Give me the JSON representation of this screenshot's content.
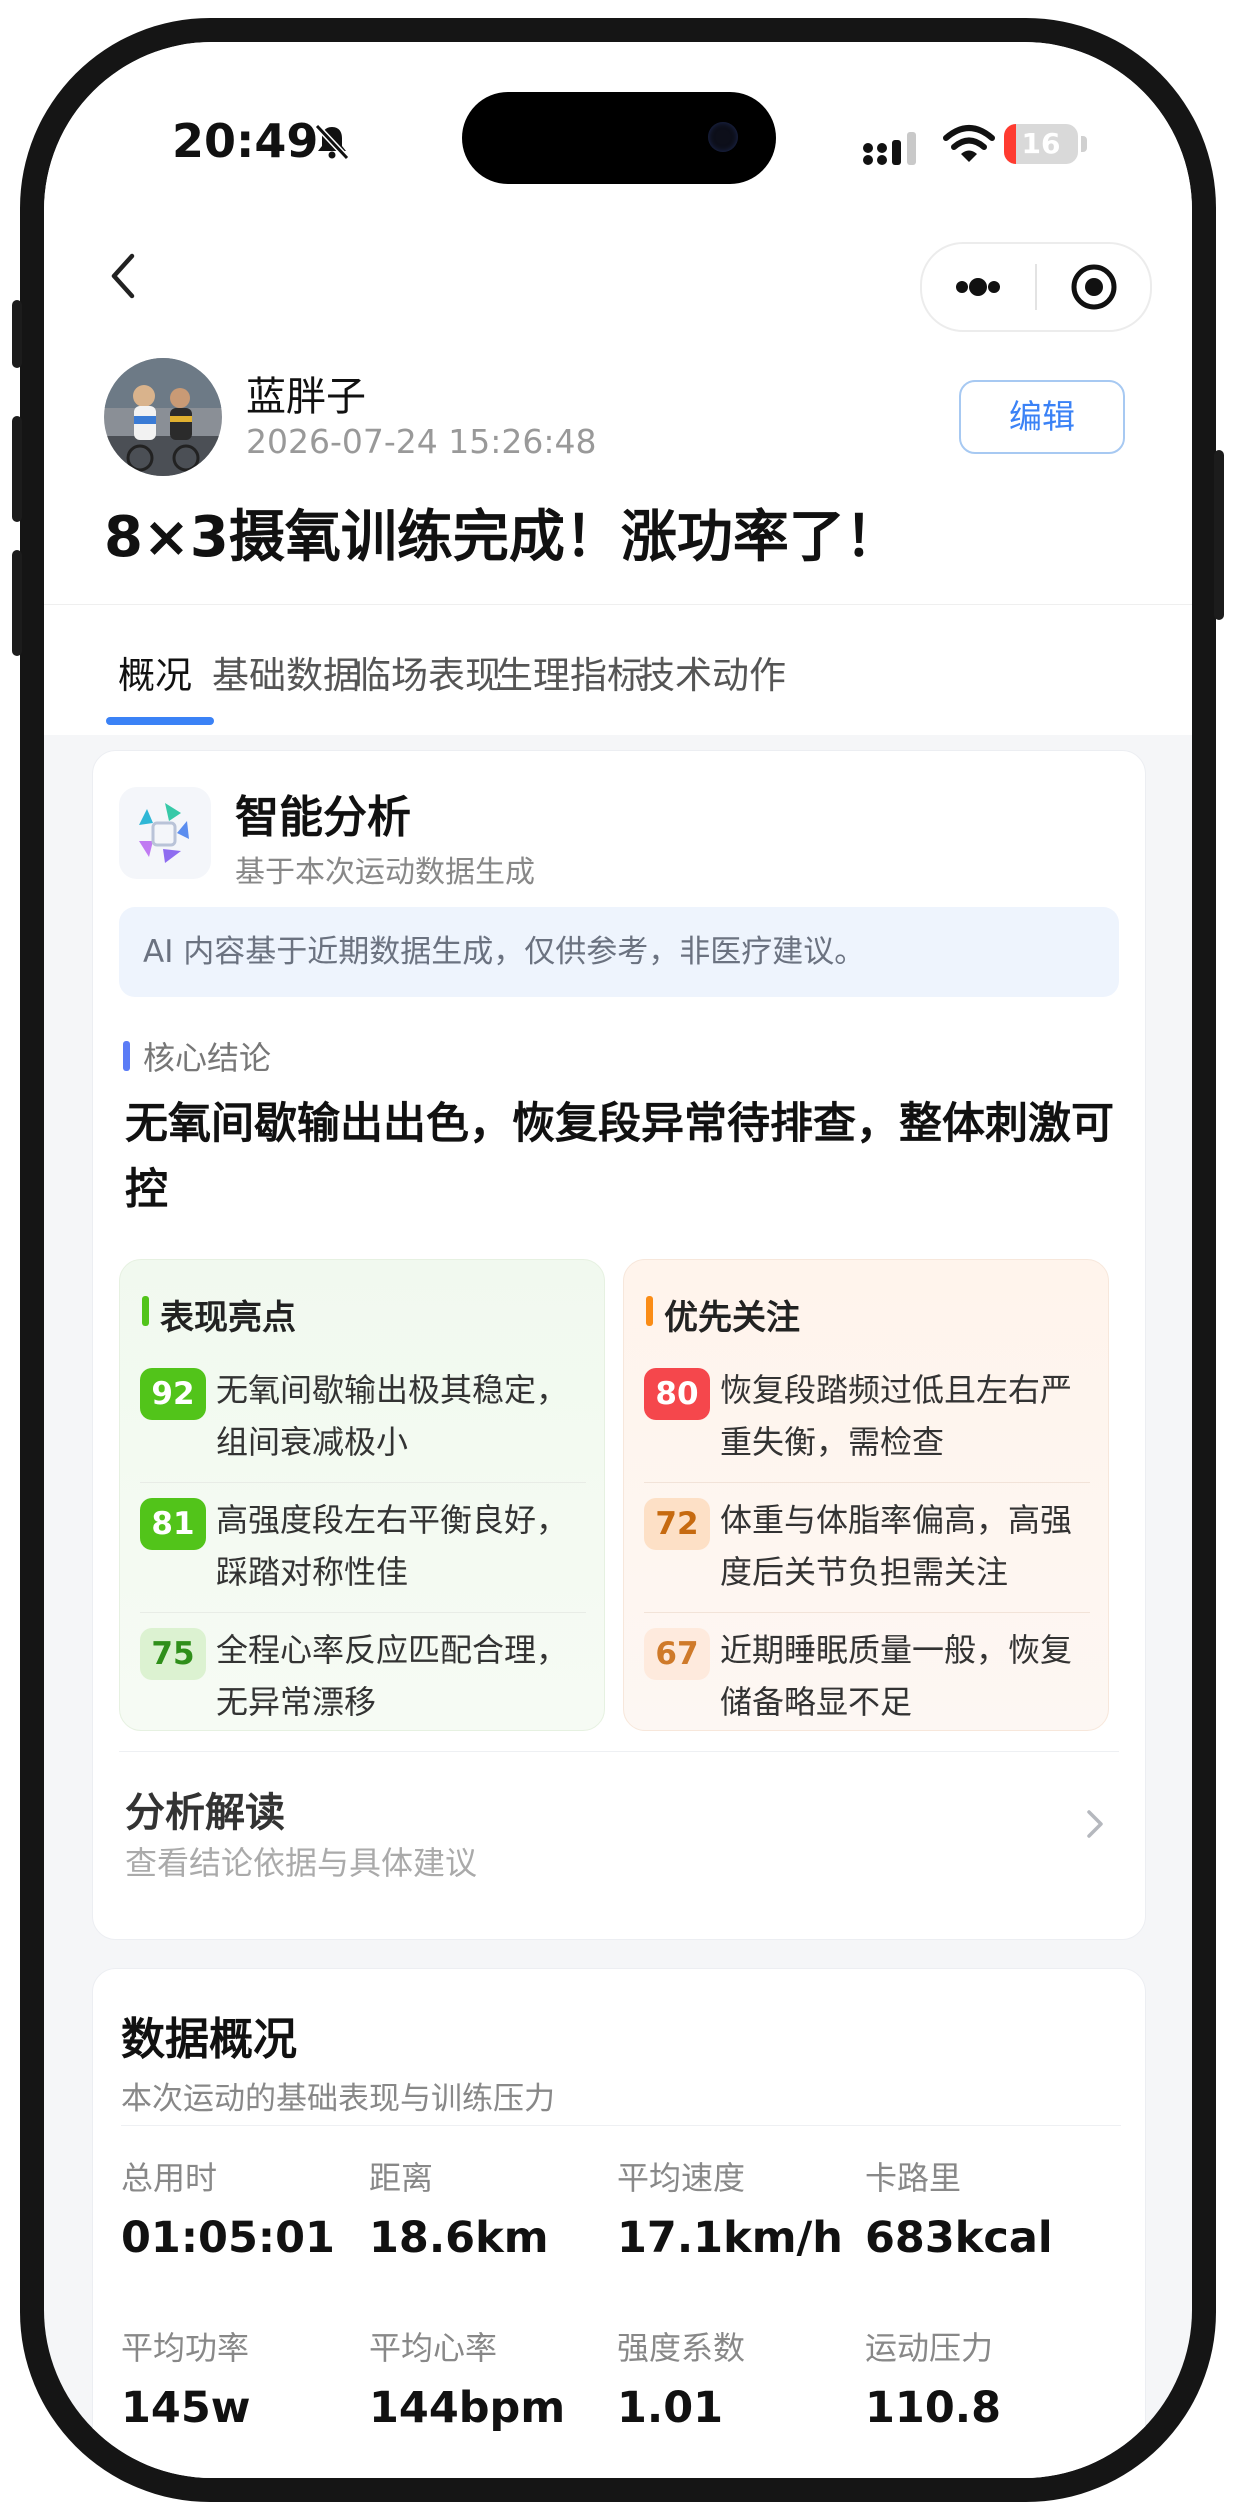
{
  "status_bar": {
    "time": "20:49",
    "battery_level": "16",
    "battery_color": "#ff3b30"
  },
  "nav": {
    "back_icon": "chevron-left-icon",
    "more_icon": "more-dots-icon",
    "close_icon": "target-close-icon"
  },
  "post": {
    "author": "蓝胖子",
    "datetime": "2026-07-24 15:26:48",
    "edit_label": "编辑",
    "title": "8×3摄氧训练完成！涨功率了！"
  },
  "tabs": [
    {
      "label": "概况",
      "active": true
    },
    {
      "label": "基础数据",
      "active": false
    },
    {
      "label": "临场表现",
      "active": false
    },
    {
      "label": "生理指标",
      "active": false
    },
    {
      "label": "技术动作",
      "active": false
    }
  ],
  "analysis": {
    "title": "智能分析",
    "subtitle": "基于本次运动数据生成",
    "disclaimer": "AI 内容基于近期数据生成，仅供参考，非医疗建议。",
    "core_label": "核心结论",
    "core_text": "无氧间歇输出出色，恢复段异常待排查，整体刺激可控",
    "highlights": {
      "title": "表现亮点",
      "accent": "#52c41a",
      "items": [
        {
          "score": "92",
          "text": "无氧间歇输出极其稳定，组间衰减极小"
        },
        {
          "score": "81",
          "text": "高强度段左右平衡良好，踩踏对称性佳"
        },
        {
          "score": "75",
          "text": "全程心率反应匹配合理，无异常漂移"
        }
      ]
    },
    "concerns": {
      "title": "优先关注",
      "accent": "#fa8c16",
      "items": [
        {
          "score": "80",
          "text": "恢复段踏频过低且左右严重失衡，需检查"
        },
        {
          "score": "72",
          "text": "体重与体脂率偏高，高强度后关节负担需关注"
        },
        {
          "score": "67",
          "text": "近期睡眠质量一般，恢复储备略显不足"
        }
      ]
    },
    "interpretation": {
      "title": "分析解读",
      "subtitle": "查看结论依据与具体建议"
    }
  },
  "data_overview": {
    "title": "数据概况",
    "subtitle": "本次运动的基础表现与训练压力",
    "stats": [
      {
        "label": "总用时",
        "value": "01:05:01"
      },
      {
        "label": "距离",
        "value": "18.6km"
      },
      {
        "label": "平均速度",
        "value": "17.1km/h"
      },
      {
        "label": "卡路里",
        "value": "683kcal"
      },
      {
        "label": "平均功率",
        "value": "145w"
      },
      {
        "label": "平均心率",
        "value": "144bpm"
      },
      {
        "label": "强度系数",
        "value": "1.01"
      },
      {
        "label": "运动压力",
        "value": "110.8"
      }
    ]
  }
}
